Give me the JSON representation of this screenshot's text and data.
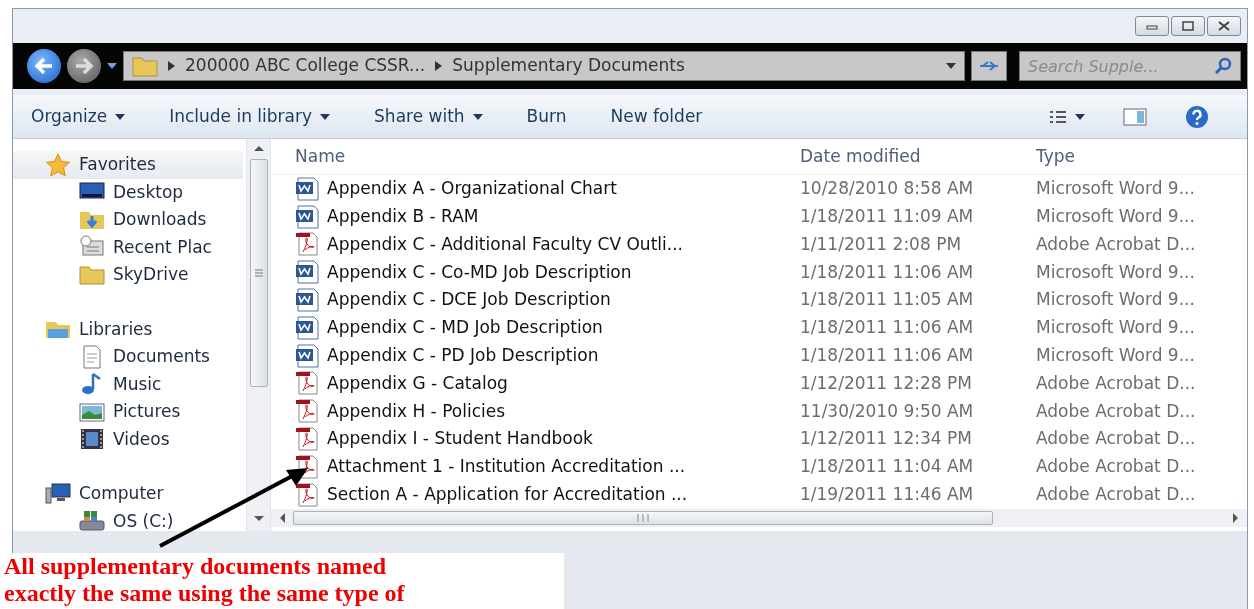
{
  "window": {
    "address": {
      "crumbs": [
        "200000 ABC College CSSR...",
        "Supplementary Documents"
      ]
    },
    "search": {
      "placeholder": "Search Supple..."
    }
  },
  "toolbar": [
    {
      "label": "Organize",
      "dropdown": true
    },
    {
      "label": "Include in library",
      "dropdown": true
    },
    {
      "label": "Share with",
      "dropdown": true
    },
    {
      "label": "Burn",
      "dropdown": false
    },
    {
      "label": "New folder",
      "dropdown": false
    }
  ],
  "sidebar": {
    "groups": [
      {
        "label": "Favorites",
        "selected": true,
        "children": [
          {
            "label": "Desktop",
            "selected": false
          },
          {
            "label": "Downloads",
            "selected": false
          },
          {
            "label": "Recent Plac",
            "selected": false
          },
          {
            "label": "SkyDrive",
            "selected": false
          }
        ]
      },
      {
        "label": "Libraries",
        "selected": false,
        "children": [
          {
            "label": "Documents",
            "selected": false
          },
          {
            "label": "Music",
            "selected": false
          },
          {
            "label": "Pictures",
            "selected": false
          },
          {
            "label": "Videos",
            "selected": false
          }
        ]
      },
      {
        "label": "Computer",
        "selected": false,
        "children": [
          {
            "label": "OS (C:)",
            "selected": false
          }
        ]
      }
    ]
  },
  "table": {
    "columns": [
      "Name",
      "Date modified",
      "Type"
    ],
    "rows": [
      {
        "kind": "word",
        "name": "Appendix A - Organizational Chart",
        "date": "10/28/2010 8:58 AM",
        "type": "Microsoft Word 9..."
      },
      {
        "kind": "word",
        "name": "Appendix B - RAM",
        "date": "1/18/2011 11:09 AM",
        "type": "Microsoft Word 9..."
      },
      {
        "kind": "pdf",
        "name": "Appendix C - Additional Faculty CV Outli...",
        "date": "1/11/2011 2:08 PM",
        "type": "Adobe Acrobat D..."
      },
      {
        "kind": "word",
        "name": "Appendix C - Co-MD Job Description",
        "date": "1/18/2011 11:06 AM",
        "type": "Microsoft Word 9..."
      },
      {
        "kind": "word",
        "name": "Appendix C - DCE Job Description",
        "date": "1/18/2011 11:05 AM",
        "type": "Microsoft Word 9..."
      },
      {
        "kind": "word",
        "name": "Appendix C - MD Job Description",
        "date": "1/18/2011 11:06 AM",
        "type": "Microsoft Word 9..."
      },
      {
        "kind": "word",
        "name": "Appendix C - PD Job Description",
        "date": "1/18/2011 11:06 AM",
        "type": "Microsoft Word 9..."
      },
      {
        "kind": "pdf",
        "name": "Appendix G - Catalog",
        "date": "1/12/2011 12:28 PM",
        "type": "Adobe Acrobat D..."
      },
      {
        "kind": "pdf",
        "name": "Appendix H - Policies",
        "date": "11/30/2010 9:50 AM",
        "type": "Adobe Acrobat D..."
      },
      {
        "kind": "pdf",
        "name": "Appendix I - Student Handbook",
        "date": "1/12/2011 12:34 PM",
        "type": "Adobe Acrobat D..."
      },
      {
        "kind": "pdf",
        "name": "Attachment 1 - Institution Accreditation ...",
        "date": "1/18/2011 11:04 AM",
        "type": "Adobe Acrobat D..."
      },
      {
        "kind": "pdf",
        "name": "Section A - Application for Accreditation ...",
        "date": "1/19/2011 11:46 AM",
        "type": "Adobe Acrobat D..."
      }
    ]
  },
  "annotation": {
    "lines": [
      "All supplementary documents named",
      "exactly the same using the same type of"
    ]
  }
}
